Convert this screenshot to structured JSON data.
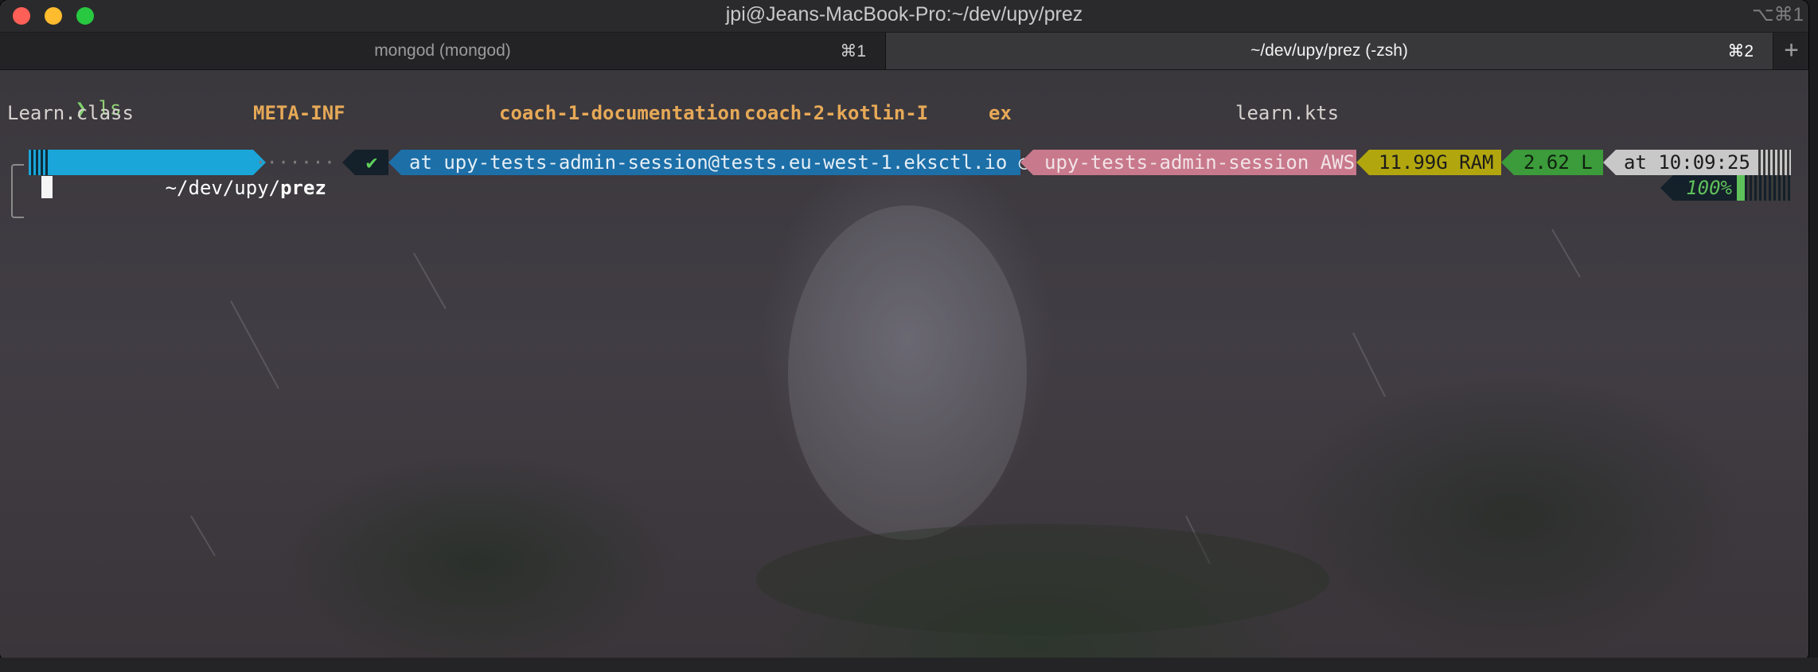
{
  "window": {
    "title": "jpi@Jeans-MacBook-Pro:~/dev/upy/prez",
    "title_shortcut": "⌥⌘1"
  },
  "tabs": [
    {
      "label": "mongod (mongod)",
      "shortcut": "⌘1",
      "active": false
    },
    {
      "label": "~/dev/upy/prez (-zsh)",
      "shortcut": "⌘2",
      "active": true
    }
  ],
  "new_tab_icon": "+",
  "terminal": {
    "prompt_symbol": "❯",
    "command": "ls",
    "ls_output": [
      {
        "name": "Learn.class",
        "kind": "file"
      },
      {
        "name": "META-INF",
        "kind": "dir"
      },
      {
        "name": "coach-1-documentation",
        "kind": "dir"
      },
      {
        "name": "coach-2-kotlin-I",
        "kind": "dir"
      },
      {
        "name": "ex",
        "kind": "dir"
      },
      {
        "name": "learn.kts",
        "kind": "file"
      }
    ],
    "powerline": {
      "path_prefix": "~/dev/upy/",
      "path_current": "prez",
      "dots": "·······",
      "status_icon": "✔",
      "kube_context": "at upy-tests-admin-session@tests.eu-west-1.eksctl.io ○",
      "aws_profile": "upy-tests-admin-session AWS",
      "ram": "11.99G RAM",
      "load": "2.62 L",
      "time": "at 10:09:25",
      "battery": "100%"
    },
    "colors": {
      "dir": "#e6a957",
      "path_bg": "#1aa6d9",
      "kube_bg": "#1d6fa8",
      "aws_bg": "#c9798c",
      "ram_bg": "#b2a60f",
      "load_bg": "#3c9b3a",
      "time_bg": "#c8c8c8"
    }
  }
}
